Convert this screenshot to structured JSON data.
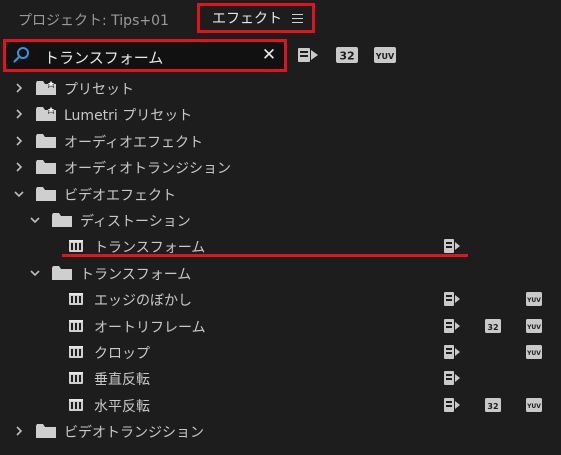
{
  "tabs": {
    "project_label": "プロジェクト: Tips+01",
    "effects_label": "エフェクト"
  },
  "search": {
    "value": "トランスフォーム"
  },
  "filters": {
    "accelerated": "",
    "bit32": "32",
    "yuv": "YUV"
  },
  "tree": [
    {
      "label": "プリセット",
      "depth": 0,
      "type": "special-folder",
      "expanded": false
    },
    {
      "label": "Lumetri プリセット",
      "depth": 0,
      "type": "special-folder",
      "expanded": false
    },
    {
      "label": "オーディオエフェクト",
      "depth": 0,
      "type": "folder",
      "expanded": false
    },
    {
      "label": "オーディオトランジション",
      "depth": 0,
      "type": "folder",
      "expanded": false
    },
    {
      "label": "ビデオエフェクト",
      "depth": 0,
      "type": "folder",
      "expanded": true
    },
    {
      "label": "ディストーション",
      "depth": 1,
      "type": "folder",
      "expanded": true
    },
    {
      "label": "トランスフォーム",
      "depth": 2,
      "type": "effect",
      "accelerated": true,
      "bit32": false,
      "yuv": false
    },
    {
      "label": "トランスフォーム",
      "depth": 1,
      "type": "folder",
      "expanded": true
    },
    {
      "label": "エッジのぼかし",
      "depth": 2,
      "type": "effect",
      "accelerated": true,
      "bit32": false,
      "yuv": true
    },
    {
      "label": "オートリフレーム",
      "depth": 2,
      "type": "effect",
      "accelerated": true,
      "bit32": true,
      "yuv": true
    },
    {
      "label": "クロップ",
      "depth": 2,
      "type": "effect",
      "accelerated": true,
      "bit32": false,
      "yuv": true
    },
    {
      "label": "垂直反転",
      "depth": 2,
      "type": "effect",
      "accelerated": true,
      "bit32": false,
      "yuv": false
    },
    {
      "label": "水平反転",
      "depth": 2,
      "type": "effect",
      "accelerated": true,
      "bit32": true,
      "yuv": true
    },
    {
      "label": "ビデオトランジション",
      "depth": 0,
      "type": "folder",
      "expanded": false
    }
  ],
  "colors": {
    "highlight": "#e0141e",
    "background": "#1d1d1d"
  }
}
